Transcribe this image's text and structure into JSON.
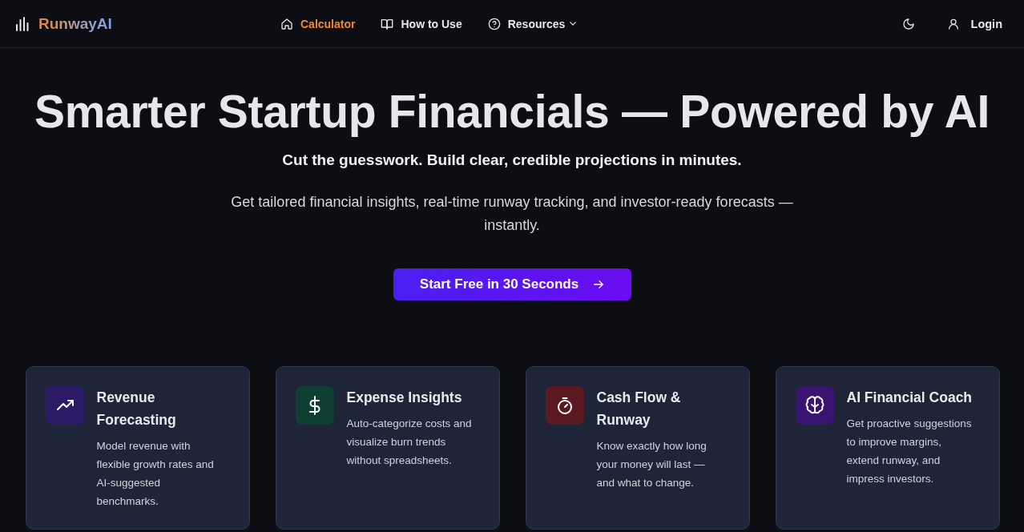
{
  "header": {
    "logo": "RunwayAI",
    "nav": [
      {
        "label": "Calculator",
        "selected": true,
        "has_menu": false
      },
      {
        "label": "How to Use",
        "selected": false,
        "has_menu": false
      },
      {
        "label": "Resources",
        "selected": false,
        "has_menu": true
      }
    ],
    "login": "Login"
  },
  "hero": {
    "title": "Smarter Startup Financials — Powered by AI",
    "subtitle": "Cut the guesswork. Build clear, credible projections in minutes.",
    "description": "Get tailored financial insights, real-time runway tracking, and investor-ready forecasts — instantly.",
    "cta": "Start Free in 30 Seconds"
  },
  "features": [
    {
      "title": "Revenue Forecasting",
      "description": "Model revenue with flexible growth rates and AI-suggested benchmarks.",
      "color": "#2b1a66"
    },
    {
      "title": "Expense Insights",
      "description": "Auto-categorize costs and visualize burn trends without spreadsheets.",
      "color": "#0f3f33"
    },
    {
      "title": "Cash Flow & Runway",
      "description": "Know exactly how long your money will last — and what to change.",
      "color": "#5b1a1f"
    },
    {
      "title": "AI Financial Coach",
      "description": "Get proactive suggestions to improve margins, extend runway, and impress investors.",
      "color": "#3a1470"
    }
  ]
}
